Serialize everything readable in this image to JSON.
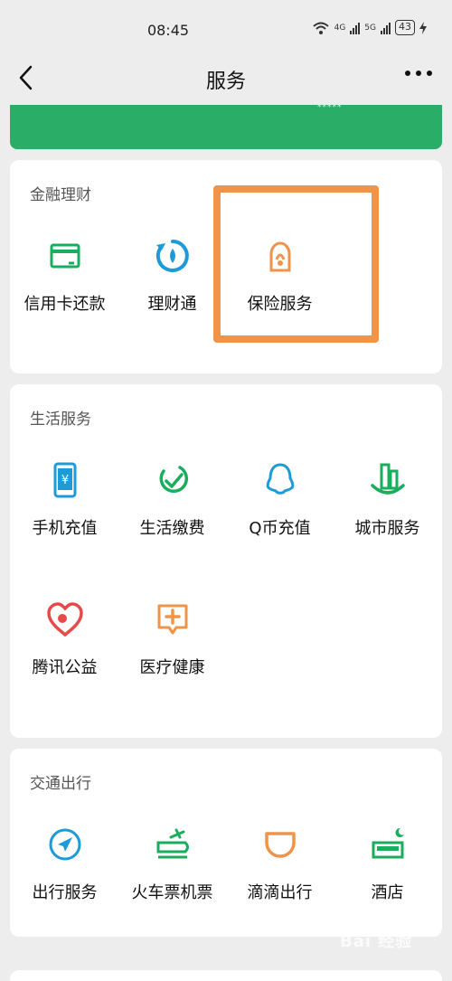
{
  "status_bar": {
    "time": "08:45",
    "network_1": "4G",
    "network_2": "5G",
    "battery": "43"
  },
  "nav": {
    "title": "服务"
  },
  "banner": {
    "text": "*****"
  },
  "sections": {
    "finance": {
      "title": "金融理财",
      "items": [
        {
          "label": "信用卡还款",
          "icon": "credit-card-icon"
        },
        {
          "label": "理财通",
          "icon": "wealth-icon"
        },
        {
          "label": "保险服务",
          "icon": "insurance-icon"
        }
      ]
    },
    "life": {
      "title": "生活服务",
      "items": [
        {
          "label": "手机充值",
          "icon": "phone-recharge-icon"
        },
        {
          "label": "生活缴费",
          "icon": "bill-payment-icon"
        },
        {
          "label": "Q币充值",
          "icon": "qq-coin-icon"
        },
        {
          "label": "城市服务",
          "icon": "city-service-icon"
        },
        {
          "label": "腾讯公益",
          "icon": "charity-heart-icon"
        },
        {
          "label": "医疗健康",
          "icon": "medical-icon"
        }
      ]
    },
    "travel": {
      "title": "交通出行",
      "items": [
        {
          "label": "出行服务",
          "icon": "navigation-icon"
        },
        {
          "label": "火车票机票",
          "icon": "train-plane-icon"
        },
        {
          "label": "滴滴出行",
          "icon": "didi-icon"
        },
        {
          "label": "酒店",
          "icon": "hotel-bed-icon"
        }
      ]
    }
  },
  "watermark": "Bai 经验",
  "colors": {
    "green": "#1aad5e",
    "blue": "#1b9bd8",
    "orange": "#f0944a",
    "red": "#e64b4b",
    "highlight": "#f0944a"
  }
}
